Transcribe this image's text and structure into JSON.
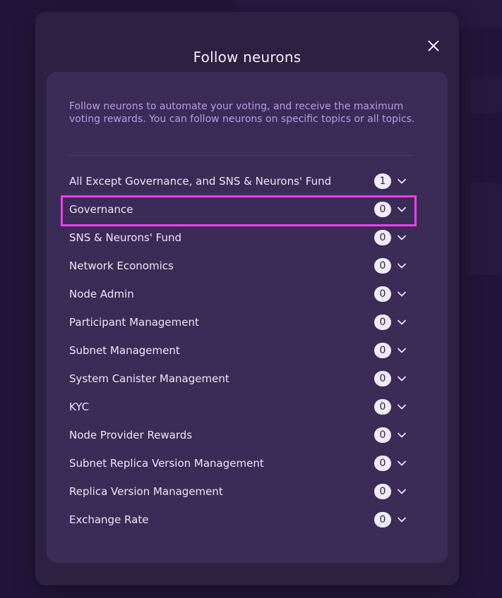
{
  "dialog": {
    "title": "Follow neurons",
    "close_icon": "close-icon",
    "intro": "Follow neurons to automate your voting, and receive the maximum voting rewards. You can follow neurons on specific topics or all topics."
  },
  "topics": [
    {
      "label": "All Except Governance, and SNS & Neurons' Fund",
      "count": "1"
    },
    {
      "label": "Governance",
      "count": "0"
    },
    {
      "label": "SNS & Neurons' Fund",
      "count": "0"
    },
    {
      "label": "Network Economics",
      "count": "0"
    },
    {
      "label": "Node Admin",
      "count": "0"
    },
    {
      "label": "Participant Management",
      "count": "0"
    },
    {
      "label": "Subnet Management",
      "count": "0"
    },
    {
      "label": "System Canister Management",
      "count": "0"
    },
    {
      "label": "KYC",
      "count": "0"
    },
    {
      "label": "Node Provider Rewards",
      "count": "0"
    },
    {
      "label": "Subnet Replica Version Management",
      "count": "0"
    },
    {
      "label": "Replica Version Management",
      "count": "0"
    },
    {
      "label": "Exchange Rate",
      "count": "0"
    }
  ],
  "colors": {
    "modal_background": "#2c2143",
    "card_background": "#3a2c57",
    "intro_text": "#b99be3",
    "highlight": "#f13cf0"
  }
}
